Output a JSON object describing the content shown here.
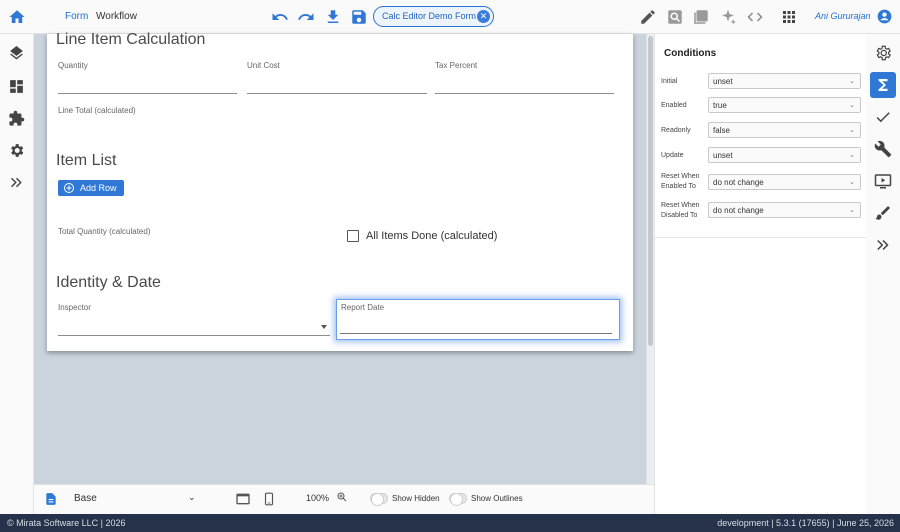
{
  "header": {
    "tabs": [
      {
        "label": "Form"
      },
      {
        "label": "Workflow"
      }
    ],
    "form_name": "Calc Editor Demo Form",
    "user_name": "Ani Gururajan"
  },
  "form": {
    "sections": [
      {
        "title": "Line Item Calculation",
        "fields": [
          "Quantity",
          "Unit Cost",
          "Tax Percent",
          "Line Total (calculated)"
        ]
      },
      {
        "title": "Item List",
        "add_row_label": "Add Row",
        "fields": [
          "Total Quantity (calculated)"
        ],
        "checkbox_label": "All Items Done (calculated)"
      },
      {
        "title": "Identity & Date",
        "fields": [
          "Inspector",
          "Report Date"
        ]
      }
    ]
  },
  "bottom_toolbar": {
    "form_version": "Base",
    "zoom": "100%",
    "show_hidden_label": "Show Hidden",
    "show_outlines_label": "Show Outlines"
  },
  "properties": {
    "title": "Conditions",
    "rows": [
      {
        "label": "Initial",
        "value": "unset"
      },
      {
        "label": "Enabled",
        "value": "true"
      },
      {
        "label": "Readonly",
        "value": "false"
      },
      {
        "label": "Update",
        "value": "unset"
      },
      {
        "label": "Reset When Enabled To",
        "value": "do not change"
      },
      {
        "label": "Reset When Disabled To",
        "value": "do not change"
      }
    ]
  },
  "footer": {
    "left": "© Mirata Software LLC | 2026",
    "right": "development | 5.3.1 (17655) | June 25, 2026"
  },
  "colors": {
    "accent": "#2f78d6",
    "footer_bg": "#26324a",
    "canvas_bg": "#cbd3dd"
  }
}
